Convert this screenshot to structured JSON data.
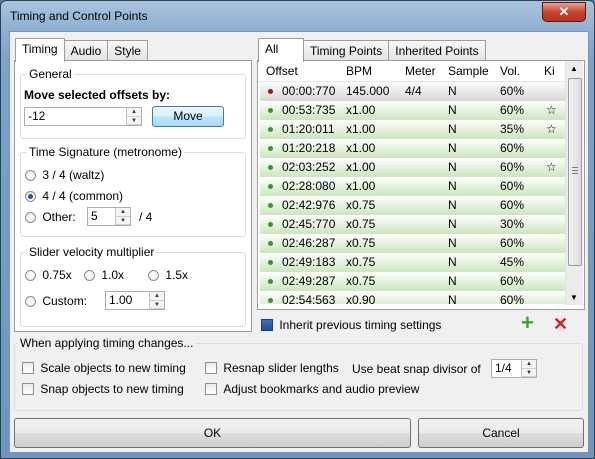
{
  "window": {
    "title": "Timing and Control Points",
    "close_glyph": "✕"
  },
  "left_tabs": [
    "Timing",
    "Audio",
    "Style"
  ],
  "general": {
    "title": "General",
    "move_label": "Move selected offsets by:",
    "offset_value": "-12",
    "move_button": "Move"
  },
  "time_signature": {
    "title": "Time Signature (metronome)",
    "waltz": "3 / 4 (waltz)",
    "common": "4 / 4 (common)",
    "other": "Other:",
    "other_value": "5",
    "suffix": "/ 4",
    "selected": "4 / 4 (common)"
  },
  "slider_velocity": {
    "title": "Slider velocity multiplier",
    "opt1": "0.75x",
    "opt2": "1.0x",
    "opt3": "1.5x",
    "custom": "Custom:",
    "custom_value": "1.00"
  },
  "right_tabs": [
    "All",
    "Timing Points",
    "Inherited Points"
  ],
  "table": {
    "columns": [
      "Offset",
      "BPM",
      "Meter",
      "Sample",
      "Vol.",
      "Ki"
    ],
    "rows": [
      {
        "offset": "00:00:770",
        "bpm": "145.000",
        "meter": "4/4",
        "sample": "N",
        "vol": "60%",
        "ki": "",
        "marker": "red"
      },
      {
        "offset": "00:53:735",
        "bpm": "x1.00",
        "meter": "",
        "sample": "N",
        "vol": "60%",
        "ki": "☆",
        "marker": "green"
      },
      {
        "offset": "01:20:011",
        "bpm": "x1.00",
        "meter": "",
        "sample": "N",
        "vol": "35%",
        "ki": "☆",
        "marker": "green"
      },
      {
        "offset": "01:20:218",
        "bpm": "x1.00",
        "meter": "",
        "sample": "N",
        "vol": "60%",
        "ki": "",
        "marker": "green"
      },
      {
        "offset": "02:03:252",
        "bpm": "x1.00",
        "meter": "",
        "sample": "N",
        "vol": "60%",
        "ki": "☆",
        "marker": "green"
      },
      {
        "offset": "02:28:080",
        "bpm": "x1.00",
        "meter": "",
        "sample": "N",
        "vol": "60%",
        "ki": "",
        "marker": "green"
      },
      {
        "offset": "02:42:976",
        "bpm": "x0.75",
        "meter": "",
        "sample": "N",
        "vol": "60%",
        "ki": "",
        "marker": "green"
      },
      {
        "offset": "02:45:770",
        "bpm": "x0.75",
        "meter": "",
        "sample": "N",
        "vol": "30%",
        "ki": "",
        "marker": "green"
      },
      {
        "offset": "02:46:287",
        "bpm": "x0.75",
        "meter": "",
        "sample": "N",
        "vol": "60%",
        "ki": "",
        "marker": "green"
      },
      {
        "offset": "02:49:183",
        "bpm": "x0.75",
        "meter": "",
        "sample": "N",
        "vol": "45%",
        "ki": "",
        "marker": "green"
      },
      {
        "offset": "02:49:287",
        "bpm": "x0.75",
        "meter": "",
        "sample": "N",
        "vol": "60%",
        "ki": "",
        "marker": "green"
      },
      {
        "offset": "02:54:563",
        "bpm": "x0.90",
        "meter": "",
        "sample": "N",
        "vol": "60%",
        "ki": "",
        "marker": "green"
      }
    ]
  },
  "inherit_label": "Inherit previous timing settings",
  "icons": {
    "add": "+",
    "remove": "✕",
    "add_color": "#3ca234",
    "remove_color": "#d21f1f"
  },
  "applying": {
    "title": "When applying timing changes...",
    "scale": "Scale objects to new timing",
    "snap": "Snap objects to new timing",
    "resnap": "Resnap slider lengths",
    "bookmarks": "Adjust bookmarks and audio preview",
    "divisor_label": "Use beat snap divisor of",
    "divisor_value": "1/4"
  },
  "footer": {
    "ok": "OK",
    "cancel": "Cancel"
  }
}
